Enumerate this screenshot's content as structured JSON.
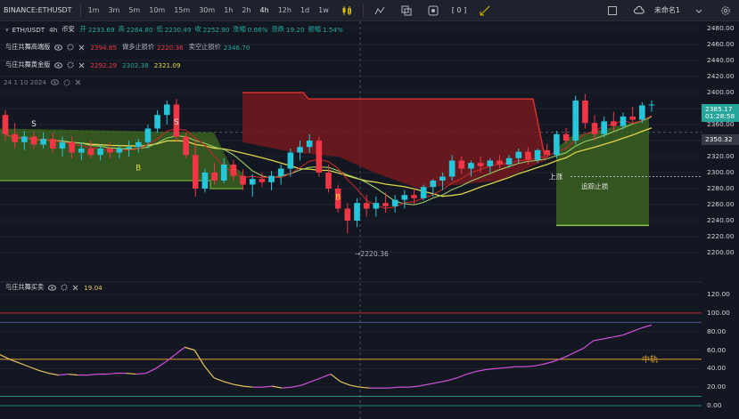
{
  "toolbar": {
    "symbol": "BINANCE:ETHUSDT",
    "timeframes": [
      "1m",
      "3m",
      "5m",
      "10m",
      "15m",
      "30m",
      "1h",
      "2h",
      "4h",
      "12h",
      "1d",
      "1w"
    ],
    "active_timeframe": "4h",
    "bracket_label": "[ 0 ]",
    "account_label": "未命名1"
  },
  "legend_main": {
    "pair": "ETH/USDT",
    "interval": "4h",
    "exchange": "币安",
    "open_label": "开",
    "open": "2233.69",
    "high_label": "高",
    "high": "2264.80",
    "low_label": "低",
    "low": "2230.49",
    "close_label": "收",
    "close": "2252.90",
    "change_pct_label": "涨幅",
    "change_pct": "0.86%",
    "change_label": "涨跌",
    "change": "19.20",
    "amplitude_label": "振幅",
    "amplitude": "1.54%"
  },
  "legend_high": {
    "name": "与庄共舞高端版",
    "v1": "2394.85",
    "long_stop_label": "做多止损价",
    "v2": "2220.36",
    "short_stop_label": "卖空止损价",
    "v3": "2346.70"
  },
  "legend_gold": {
    "name": "与庄共舞黄金版",
    "v1": "2292.29",
    "v2": "2302.38",
    "v3": "2321.09"
  },
  "legend_2024": {
    "text": "24 1 10 2024"
  },
  "legend_osc": {
    "name": "与庄共舞买卖",
    "value": "19.04"
  },
  "price_axis": [
    "2480.00",
    "2460.00",
    "2440.00",
    "2420.00",
    "2400.00",
    "2380.00",
    "2360.00",
    "2340.00",
    "2320.00",
    "2300.00",
    "2280.00",
    "2260.00",
    "2240.00",
    "2220.00",
    "2200.00"
  ],
  "osc_axis": [
    "120.00",
    "100.00",
    "80.00",
    "60.00",
    "40.00",
    "20.00",
    "0.00"
  ],
  "price_tags": {
    "last": "2385.17",
    "countdown": "01:28:58",
    "crosshair": "2350.32"
  },
  "annotations": {
    "low_marker": "2220.36",
    "rise_label": "上涨",
    "trail_stop_label": "追踪止损",
    "mid_rail_label": "中轨",
    "b_label": "B",
    "s_label": "S"
  },
  "colors": {
    "up": "#26c6da",
    "down": "#f23645",
    "bull_zone": "#3f6b1f",
    "bear_zone": "#7a1a1f",
    "ma_yellow": "#e0d44a",
    "ma_green": "#9ccc65",
    "ma_red": "#c62828",
    "osc_purple": "#d451e0",
    "osc_yellow": "#e6c65c"
  },
  "chart_data": {
    "type": "candlestick",
    "price_range": [
      2200,
      2480
    ],
    "osc_range": [
      0,
      120
    ],
    "candles": [
      [
        2372,
        2378,
        2340,
        2348
      ],
      [
        2348,
        2362,
        2330,
        2338
      ],
      [
        2338,
        2352,
        2328,
        2345
      ],
      [
        2345,
        2352,
        2330,
        2335
      ],
      [
        2335,
        2350,
        2330,
        2342
      ],
      [
        2342,
        2350,
        2325,
        2330
      ],
      [
        2330,
        2345,
        2320,
        2338
      ],
      [
        2338,
        2345,
        2318,
        2325
      ],
      [
        2325,
        2338,
        2315,
        2330
      ],
      [
        2330,
        2340,
        2318,
        2322
      ],
      [
        2322,
        2335,
        2315,
        2330
      ],
      [
        2330,
        2338,
        2318,
        2325
      ],
      [
        2325,
        2335,
        2318,
        2330
      ],
      [
        2330,
        2340,
        2320,
        2332
      ],
      [
        2332,
        2342,
        2325,
        2338
      ],
      [
        2338,
        2360,
        2330,
        2355
      ],
      [
        2355,
        2378,
        2350,
        2372
      ],
      [
        2372,
        2390,
        2360,
        2385
      ],
      [
        2385,
        2392,
        2338,
        2345
      ],
      [
        2345,
        2350,
        2318,
        2322
      ],
      [
        2322,
        2340,
        2270,
        2280
      ],
      [
        2280,
        2305,
        2275,
        2300
      ],
      [
        2300,
        2312,
        2285,
        2290
      ],
      [
        2290,
        2318,
        2287,
        2310
      ],
      [
        2310,
        2316,
        2290,
        2296
      ],
      [
        2296,
        2304,
        2278,
        2285
      ],
      [
        2285,
        2298,
        2270,
        2292
      ],
      [
        2292,
        2300,
        2282,
        2288
      ],
      [
        2288,
        2302,
        2278,
        2296
      ],
      [
        2296,
        2310,
        2285,
        2305
      ],
      [
        2305,
        2330,
        2295,
        2325
      ],
      [
        2325,
        2340,
        2315,
        2332
      ],
      [
        2332,
        2348,
        2325,
        2340
      ],
      [
        2340,
        2345,
        2295,
        2300
      ],
      [
        2300,
        2310,
        2275,
        2280
      ],
      [
        2280,
        2285,
        2250,
        2255
      ],
      [
        2255,
        2262,
        2224,
        2240
      ],
      [
        2240,
        2268,
        2232,
        2262
      ],
      [
        2262,
        2272,
        2245,
        2255
      ],
      [
        2255,
        2270,
        2245,
        2262
      ],
      [
        2262,
        2275,
        2250,
        2258
      ],
      [
        2258,
        2272,
        2250,
        2266
      ],
      [
        2266,
        2278,
        2255,
        2272
      ],
      [
        2272,
        2280,
        2260,
        2268
      ],
      [
        2268,
        2285,
        2265,
        2282
      ],
      [
        2282,
        2292,
        2270,
        2290
      ],
      [
        2290,
        2300,
        2278,
        2295
      ],
      [
        2295,
        2322,
        2290,
        2315
      ],
      [
        2315,
        2320,
        2298,
        2305
      ],
      [
        2305,
        2315,
        2295,
        2312
      ],
      [
        2312,
        2320,
        2300,
        2308
      ],
      [
        2308,
        2318,
        2300,
        2315
      ],
      [
        2315,
        2322,
        2305,
        2310
      ],
      [
        2310,
        2322,
        2306,
        2318
      ],
      [
        2318,
        2330,
        2312,
        2326
      ],
      [
        2326,
        2332,
        2310,
        2316
      ],
      [
        2316,
        2330,
        2312,
        2328
      ],
      [
        2328,
        2336,
        2318,
        2322
      ],
      [
        2322,
        2352,
        2318,
        2348
      ],
      [
        2348,
        2356,
        2336,
        2340
      ],
      [
        2340,
        2396,
        2335,
        2390
      ],
      [
        2390,
        2398,
        2355,
        2362
      ],
      [
        2362,
        2372,
        2340,
        2348
      ],
      [
        2348,
        2370,
        2344,
        2364
      ],
      [
        2364,
        2376,
        2352,
        2358
      ],
      [
        2358,
        2375,
        2354,
        2370
      ],
      [
        2370,
        2382,
        2362,
        2366
      ],
      [
        2366,
        2388,
        2362,
        2384
      ],
      [
        2384,
        2390,
        2376,
        2385
      ]
    ],
    "oscillator": [
      55,
      50,
      46,
      42,
      38,
      35,
      33,
      34,
      33,
      33,
      34,
      34,
      35,
      35,
      34,
      35,
      40,
      47,
      55,
      63,
      60,
      43,
      30,
      26,
      23,
      21,
      20,
      20,
      21,
      19,
      20,
      22,
      26,
      30,
      34,
      26,
      22,
      20,
      19,
      19,
      19,
      20,
      20,
      21,
      23,
      25,
      27,
      30,
      34,
      37,
      39,
      40,
      41,
      42,
      42,
      43,
      45,
      48,
      52,
      57,
      62,
      70,
      72,
      74,
      76,
      80,
      84,
      87
    ]
  }
}
